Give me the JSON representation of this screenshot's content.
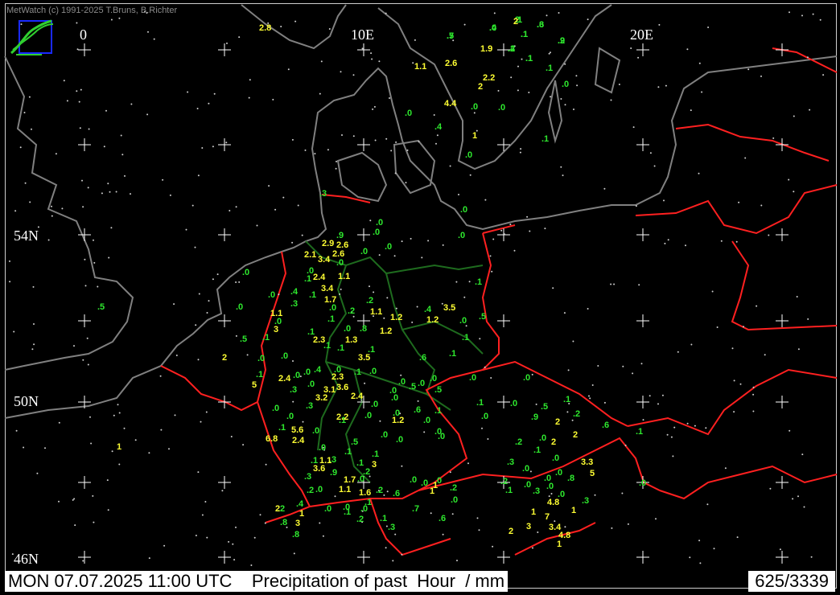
{
  "header": {
    "credit": "MetWatch  (c) 1991-2025 T.Bruns, B.Richter"
  },
  "footer": {
    "title": "MON 07.07.2025 11:00 UTC    Precipitation of past  Hour  / mm",
    "station_count": "625/3339"
  },
  "grid_labels": {
    "lon_0": "0",
    "lon_10": "10E",
    "lon_20": "20E",
    "lat_54": "54N",
    "lat_50": "50N",
    "lat_46": "46N"
  },
  "colors": {
    "background": "#000000",
    "coast": "#808080",
    "border": "#ff2020",
    "german_states": "#1e6b1e",
    "value_small": "#2ee82e",
    "value_large": "#ffff33"
  },
  "observations_small": [
    ".7",
    ".4",
    "2",
    ".1",
    ".6",
    ".2",
    ".9",
    ".1",
    ".1",
    ".0",
    ".0",
    ".0",
    ".4",
    ".0",
    ".0",
    ".1",
    ".3",
    ".0",
    ".0",
    ".0",
    ".9",
    ".0",
    ".0",
    ".0",
    ".0",
    ".0",
    ".0",
    ".0",
    ".1",
    ".1",
    ".4",
    ".1",
    ".3",
    ".0",
    ".5",
    ".0",
    ".2",
    ".0",
    ".1",
    ".5",
    ".1",
    ".8",
    ".0",
    ".1",
    ".1",
    ".4",
    ".1",
    ".5",
    ".0",
    ".2",
    ".1",
    ".1",
    ".6",
    ".1",
    ".4",
    ".1",
    ".0",
    ".0",
    ".0",
    ".1",
    ".0",
    ".0",
    ".0",
    ".3",
    ".0",
    ".0",
    ".5",
    ".0",
    ".0",
    ".0",
    ".0",
    ".5",
    ".0",
    ".0",
    ".1",
    ".0",
    ".0",
    ".3",
    ".1",
    ".0",
    ".1",
    ".0",
    ".0",
    ".0",
    ".6",
    ".1",
    ".0",
    ".0",
    ".0",
    ".0",
    ".0",
    ".0",
    ".5",
    ".9",
    ".2",
    ".6",
    ".1",
    ".2",
    ".1",
    ".0",
    ".0",
    ".0",
    ".3",
    ".0",
    ".0",
    ".8",
    ".0",
    ".1",
    ".0",
    ".2",
    ".1",
    ".0",
    ".3",
    ".0",
    ".0",
    ".3",
    ".0",
    ".0",
    ".0",
    ".2",
    ".0",
    ".6",
    ".7",
    ".6",
    ".2",
    ".1",
    ".3",
    ".1",
    ".2",
    ".0",
    ".0",
    ".0",
    ".1",
    ".8",
    ".8",
    ".2",
    ".4",
    ".2",
    ".0",
    ".1",
    ".3",
    ".1",
    ".5",
    ".1",
    ".2",
    ".1",
    ".0",
    ".9",
    ".0",
    ".3",
    ".5",
    ".0",
    ".1",
    ".1",
    ".3",
    ".4",
    ".2",
    ".1"
  ],
  "observations_large": [
    "2.8",
    "1.9",
    "2",
    "1.1",
    "2.6",
    "2.2",
    "2",
    "4.4",
    "1",
    "2.9",
    "2.6",
    "2.1",
    "3.4",
    "2.6",
    "2.4",
    "1.1",
    "3.4",
    "1.7",
    "1.1",
    "1.1",
    "1.2",
    "3.5",
    "3",
    "1.2",
    "2.3",
    "1.3",
    "1.2",
    "3.5",
    "2",
    "2.4",
    "2.3",
    "3.1",
    "3.6",
    "3.2",
    "2.4",
    "5",
    "1.2",
    "2.2",
    "5.6",
    "2.4",
    "6.8",
    "1",
    "2",
    "2",
    "2",
    "1.1",
    "3.6",
    "3",
    "3.3",
    "5",
    "1",
    "1.7",
    "1.1",
    "1.6",
    "1",
    "2",
    "1",
    "3",
    "4.8",
    "7",
    "1",
    "3.4",
    "4.8",
    "2",
    "3",
    "1",
    "1"
  ]
}
